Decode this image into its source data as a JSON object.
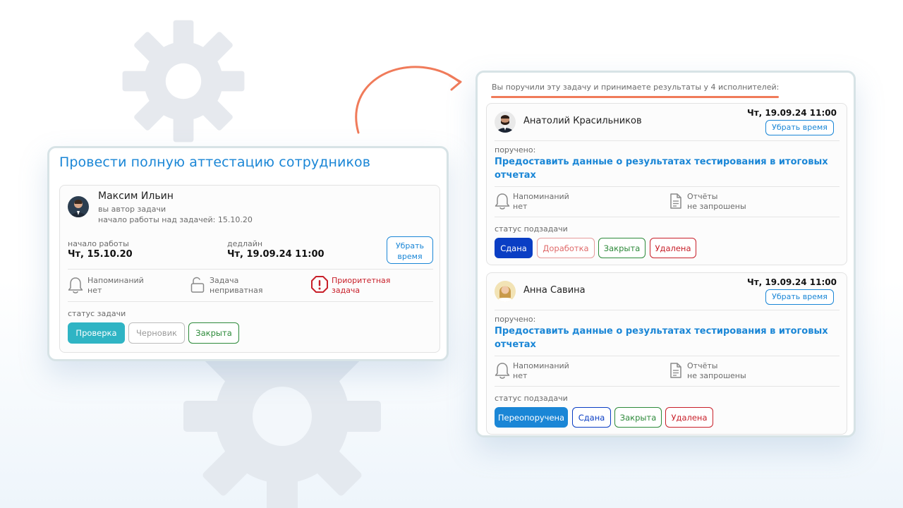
{
  "colors": {
    "accent": "#1a86d6",
    "orange_arrow": "#f07b5a",
    "teal": "#2fb4c4",
    "navy": "#0a3ec4",
    "red": "#c8202a",
    "green": "#2d8a3a"
  },
  "main": {
    "title": "Провести полную аттестацию сотрудников",
    "author": {
      "name": "Максим Ильин",
      "role": "вы автор задачи",
      "work_start": "начало работы над задачей: 15.10.20"
    },
    "start_label": "начало работы",
    "start_value": "Чт, 15.10.20",
    "deadline_label": "дедлайн",
    "deadline_value": "Чт, 19.09.24 11:00",
    "remove_time_line1": "Убрать",
    "remove_time_line2": "время",
    "reminders_label": "Напоминаний",
    "reminders_value": "нет",
    "private_label": "Задача",
    "private_value": "неприватная",
    "priority_line1": "Приоритетная",
    "priority_line2": "задача",
    "status_label": "статус задачи",
    "statuses": [
      "Проверка",
      "Черновик",
      "Закрыта"
    ]
  },
  "right": {
    "header": "Вы поручили эту задачу и принимаете результаты у 4 исполнителей:",
    "subtasks": [
      {
        "name": "Анатолий Красильников",
        "date": "Чт, 19.09.24 11:00",
        "remove_time": "Убрать время",
        "assigned_label": "поручено:",
        "assigned_line1": "Предоставить данные о результатах тестирования в итоговых",
        "assigned_line2": "отчетах",
        "reminders_label": "Напоминаний",
        "reminders_value": "нет",
        "reports_label": "Отчёты",
        "reports_value": "не запрошены",
        "status_label": "статус подзадачи",
        "statuses": [
          "Сдана",
          "Доработка",
          "Закрыта",
          "Удалена"
        ]
      },
      {
        "name": "Анна Савина",
        "date": "Чт, 19.09.24 11:00",
        "remove_time": "Убрать время",
        "assigned_label": "поручено:",
        "assigned_line1": "Предоставить данные о результатах тестирования в итоговых",
        "assigned_line2": "отчетах",
        "reminders_label": "Напоминаний",
        "reminders_value": "нет",
        "reports_label": "Отчёты",
        "reports_value": "не запрошены",
        "status_label": "статус подзадачи",
        "statuses": [
          "Переопоручена",
          "Сдана",
          "Закрыта",
          "Удалена"
        ]
      }
    ]
  }
}
